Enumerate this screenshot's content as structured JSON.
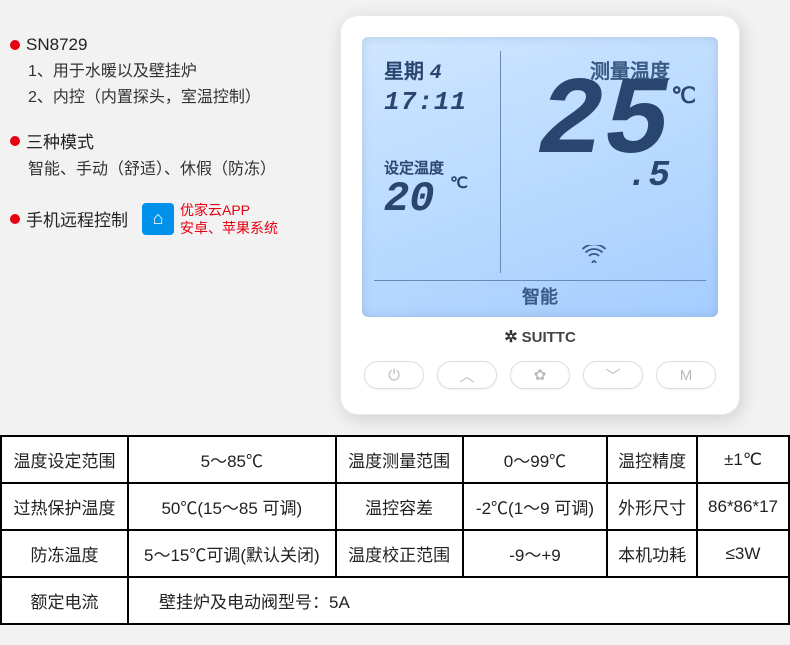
{
  "features": {
    "model": {
      "title": "SN8729",
      "lines": [
        "1、用于水暖以及壁挂炉",
        "2、内控（内置探头，室温控制）"
      ]
    },
    "modes": {
      "title": "三种模式",
      "line": "智能、手动（舒适）、休假（防冻）"
    },
    "remote": {
      "title": "手机远程控制",
      "app_name": "优家云APP",
      "app_platforms": "安卓、苹果系统"
    }
  },
  "device": {
    "brand": "SUITTC",
    "screen": {
      "day_prefix": "星期",
      "day_value": "4",
      "time": "17:11",
      "set_label": "设定温度",
      "set_temp": "20",
      "set_unit": "℃",
      "meas_label": "测量温度",
      "meas_temp_int": "25",
      "meas_temp_frac": ".5",
      "meas_unit": "℃",
      "mode": "智能"
    },
    "buttons": {
      "power": "⏻",
      "up": "︿",
      "set": "✿",
      "down": "﹀",
      "menu": "M"
    }
  },
  "specs": {
    "r1": {
      "c1": "温度设定范围",
      "c2": "5～85℃",
      "c3": "温度测量范围",
      "c4": "0～99℃",
      "c5": "温控精度",
      "c6": "±1℃"
    },
    "r2": {
      "c1": "过热保护温度",
      "c2": "50℃(15～85 可调)",
      "c3": "温控容差",
      "c4": "-2℃(1～9 可调)",
      "c5": "外形尺寸",
      "c6": "86*86*17"
    },
    "r3": {
      "c1": "防冻温度",
      "c2": "5～15℃可调(默认关闭)",
      "c3": "温度校正范围",
      "c4": "-9～+9",
      "c5": "本机功耗",
      "c6": "≤3W"
    },
    "r4": {
      "c1": "额定电流",
      "c2": "壁挂炉及电动阀型号：5A"
    }
  }
}
